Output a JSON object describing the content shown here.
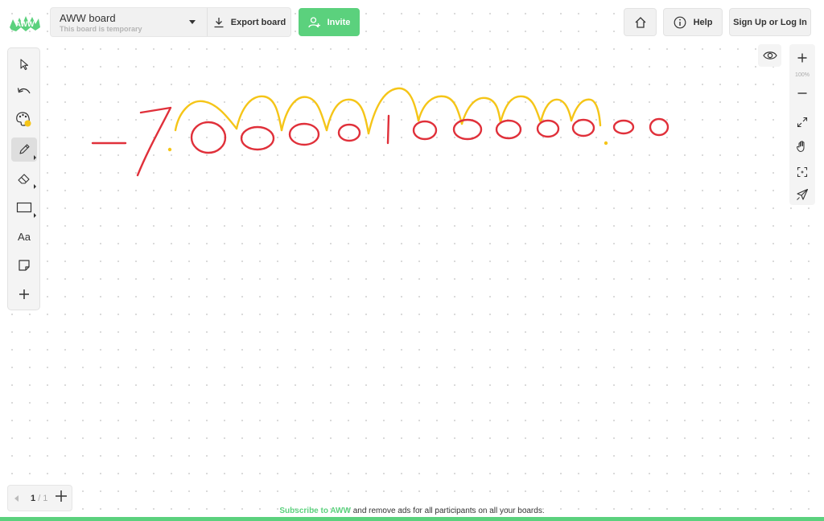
{
  "app": {
    "name": "AWW",
    "logo_text": "AWW"
  },
  "board": {
    "title": "AWW board",
    "subtitle": "This board is temporary",
    "export_label": "Export board"
  },
  "header": {
    "invite_label": "Invite",
    "help_label": "Help",
    "signup_label": "Sign Up or Log In"
  },
  "toolbar": {
    "items": [
      {
        "name": "select",
        "icon": "cursor-arrow-icon"
      },
      {
        "name": "undo",
        "icon": "undo-icon"
      },
      {
        "name": "color",
        "icon": "palette-icon",
        "color": "#f5c518"
      },
      {
        "name": "pen",
        "icon": "pencil-icon",
        "active": true
      },
      {
        "name": "eraser",
        "icon": "eraser-icon"
      },
      {
        "name": "shape",
        "icon": "rectangle-icon"
      },
      {
        "name": "text",
        "icon": "text-icon",
        "label": "Aa"
      },
      {
        "name": "sticky-note",
        "icon": "sticky-note-icon"
      },
      {
        "name": "add",
        "icon": "plus-icon"
      }
    ]
  },
  "zoom": {
    "level": "100%"
  },
  "pager": {
    "current": "1",
    "total": "/ 1"
  },
  "footer": {
    "link_text": "Subscribe to AWW",
    "rest_text": " and remove ads for all participants on all your boards."
  },
  "colors": {
    "accent": "#5bd17d",
    "ink_red": "#e0303a",
    "ink_yellow": "#f5c518"
  }
}
